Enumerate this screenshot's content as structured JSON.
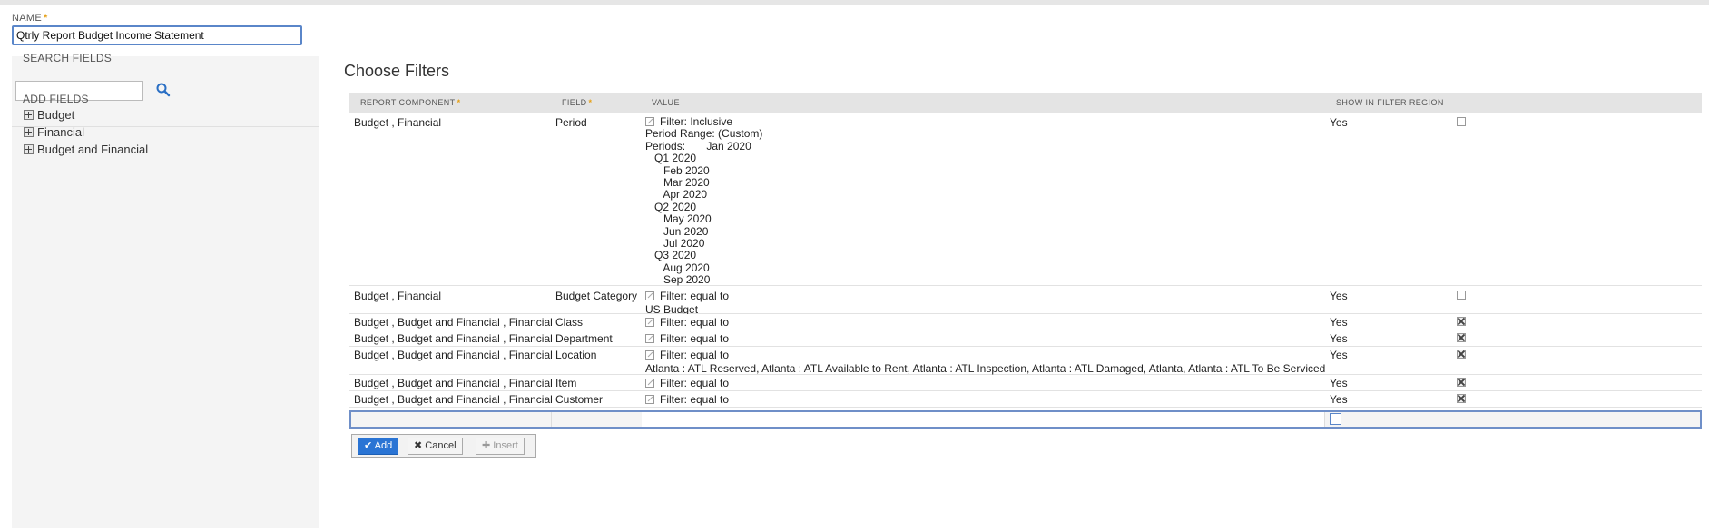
{
  "form": {
    "name_label": "NAME",
    "required_mark": "*",
    "name_value": "Qtrly Report Budget Income Statement"
  },
  "sidebar": {
    "search_heading": "SEARCH FIELDS",
    "search_placeholder": "",
    "add_heading": "ADD FIELDS",
    "items": [
      {
        "label": "Budget"
      },
      {
        "label": "Financial"
      },
      {
        "label": "Budget and Financial"
      }
    ]
  },
  "main": {
    "title": "Choose Filters",
    "columns": {
      "report_component": "REPORT COMPONENT",
      "field": "FIELD",
      "value": "VALUE",
      "show_in_filter_region": "SHOW IN FILTER REGION"
    },
    "rows": [
      {
        "component": "Budget , Financial",
        "field": "Period",
        "filter": "Filter: Inclusive",
        "details": [
          "Period Range: (Custom)",
          "Periods:       Jan 2020",
          "   Q1 2020",
          "      Feb 2020",
          "      Mar 2020",
          "      Apr 2020",
          "   Q2 2020",
          "      May 2020",
          "      Jun 2020",
          "      Jul 2020",
          "   Q3 2020",
          "      Aug 2020",
          "      Sep 2020"
        ],
        "show": "Yes",
        "checked": false
      },
      {
        "component": "Budget , Financial",
        "field": "Budget Category",
        "filter": "Filter: equal to",
        "details": [
          "US Budget"
        ],
        "show": "Yes",
        "checked": false
      },
      {
        "component": "Budget , Budget and Financial , Financial",
        "field": "Class",
        "filter": "Filter: equal to",
        "details": [],
        "show": "Yes",
        "checked": true
      },
      {
        "component": "Budget , Budget and Financial , Financial",
        "field": "Department",
        "filter": "Filter: equal to",
        "details": [],
        "show": "Yes",
        "checked": true
      },
      {
        "component": "Budget , Budget and Financial , Financial",
        "field": "Location",
        "filter": "Filter: equal to",
        "details": [
          "Atlanta : ATL Reserved, Atlanta : ATL Available to Rent, Atlanta : ATL Inspection, Atlanta : ATL Damaged, Atlanta, Atlanta : ATL To Be Serviced"
        ],
        "show": "Yes",
        "checked": true
      },
      {
        "component": "Budget , Budget and Financial , Financial",
        "field": "Item",
        "filter": "Filter: equal to",
        "details": [],
        "show": "Yes",
        "checked": true
      },
      {
        "component": "Budget , Budget and Financial , Financial",
        "field": "Customer",
        "filter": "Filter: equal to",
        "details": [],
        "show": "Yes",
        "checked": true
      }
    ],
    "buttons": {
      "add": "Add",
      "cancel": "Cancel",
      "insert": "Insert"
    }
  },
  "colors": {
    "accent": "#2a74d4",
    "required": "#e6a118",
    "header_bg": "#e4e4e4"
  }
}
